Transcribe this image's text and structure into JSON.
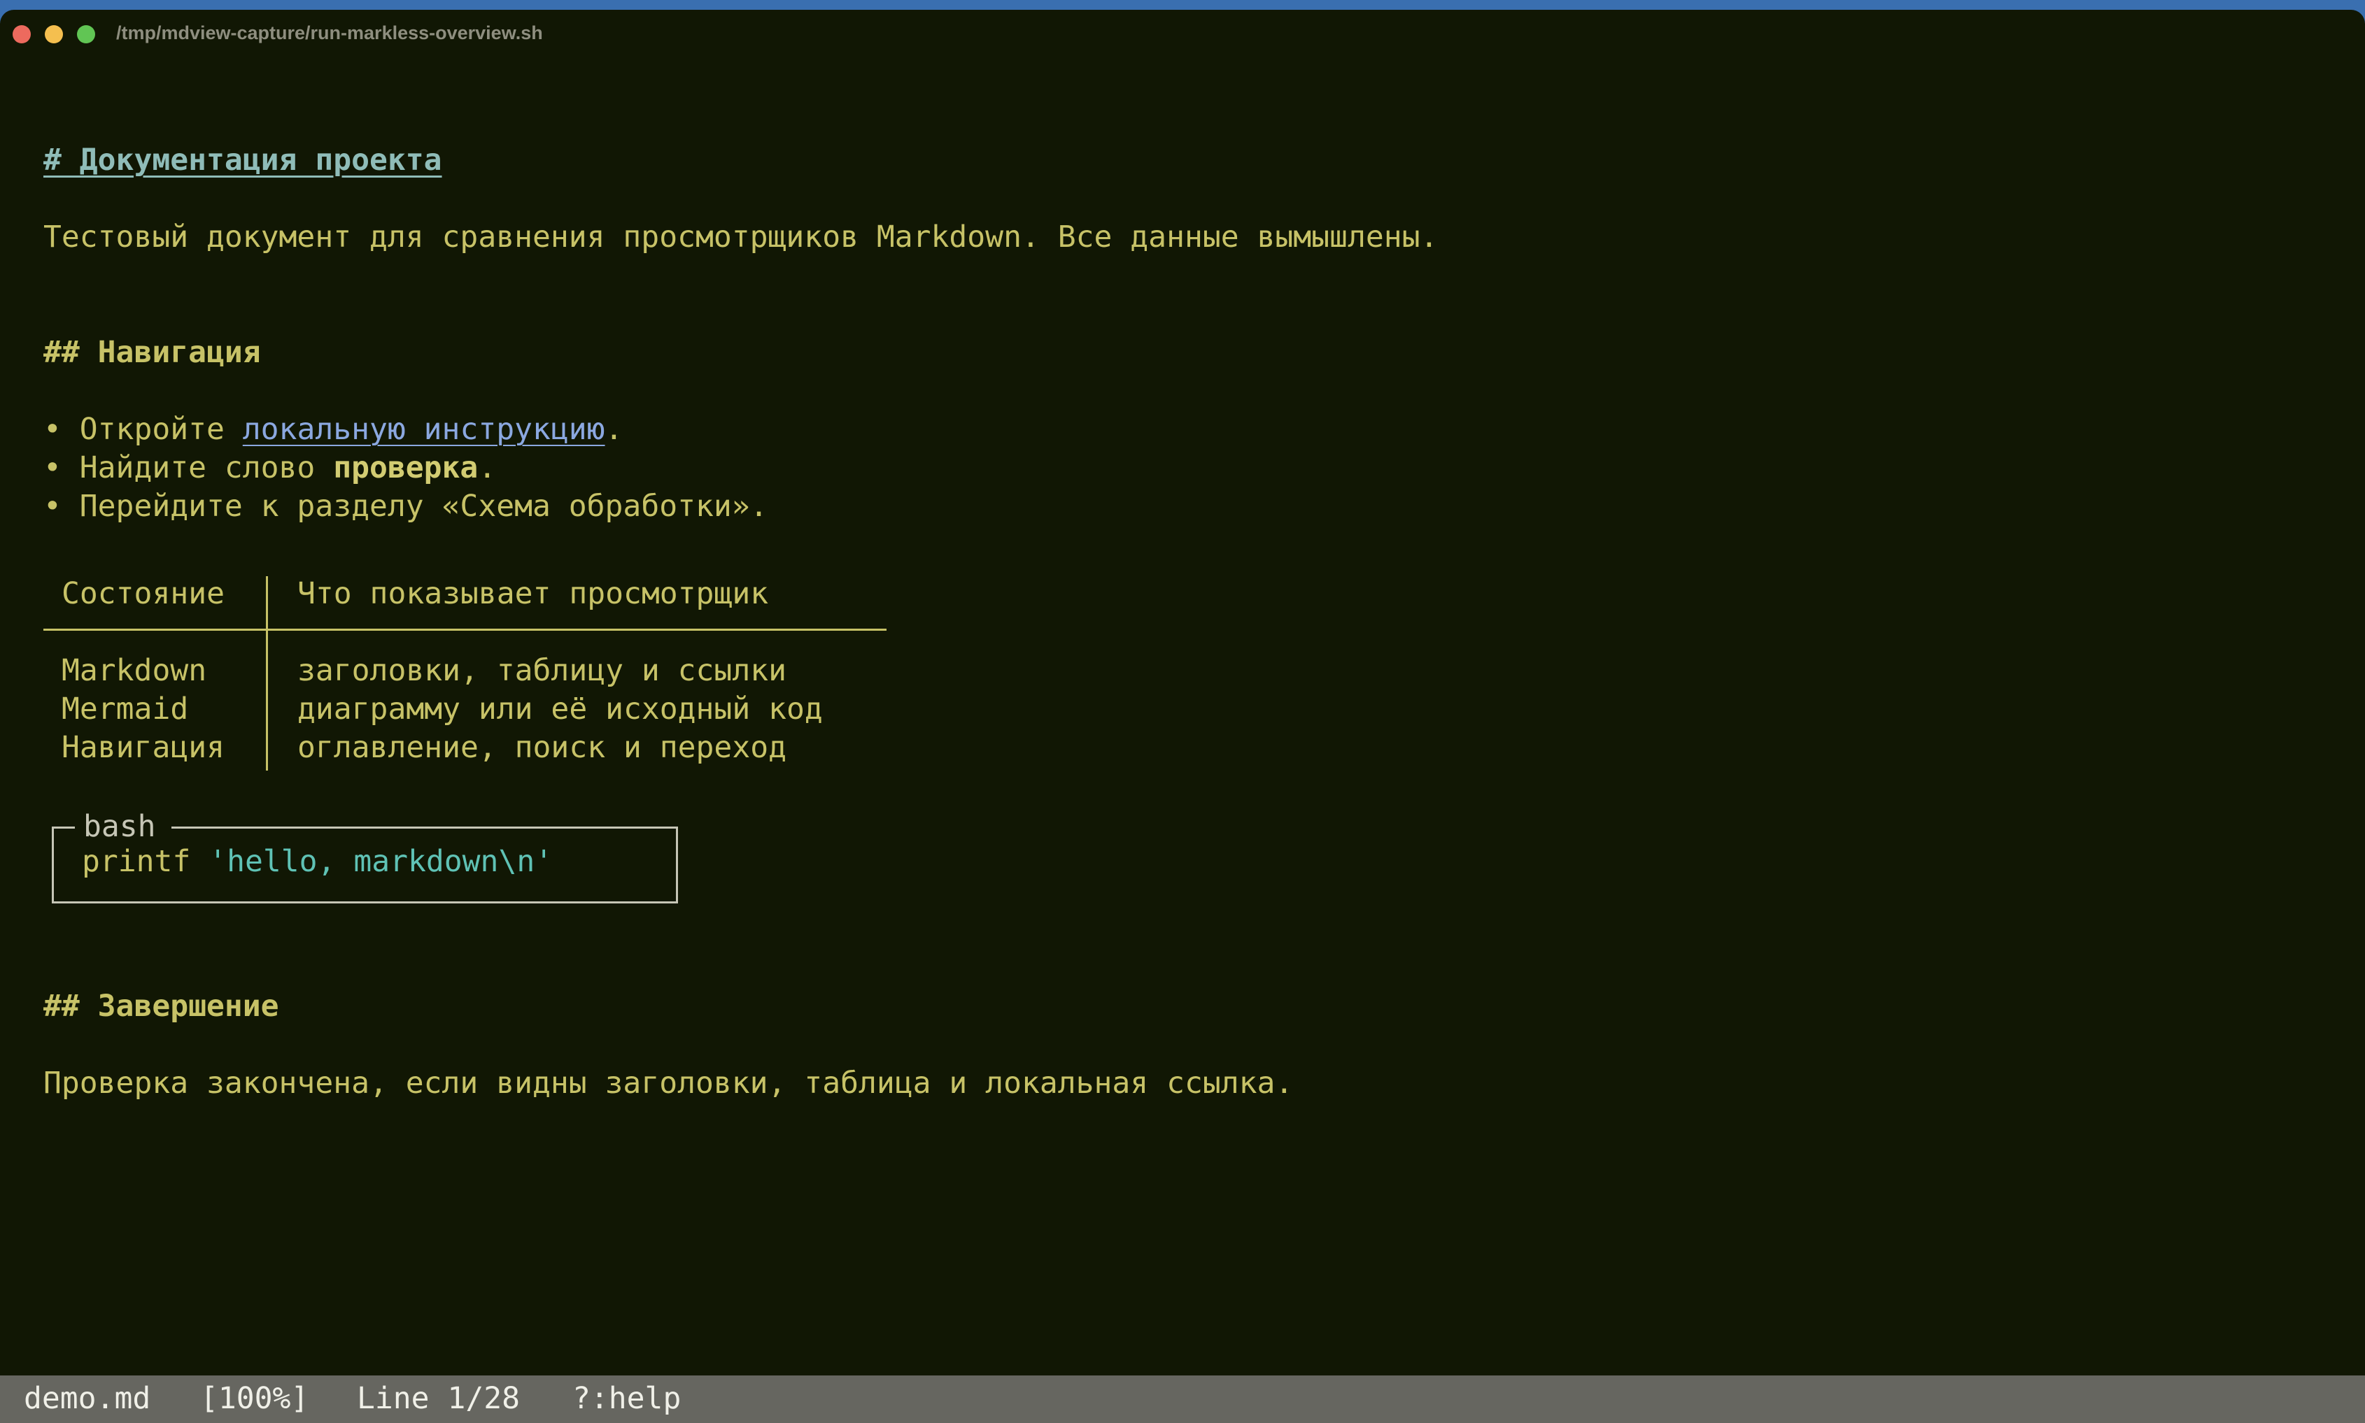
{
  "window": {
    "title": "/tmp/mdview-capture/run-markless-overview.sh"
  },
  "document": {
    "h1": "# Документация проекта",
    "intro": "Тестовый документ для сравнения просмотрщиков Markdown. Все данные вымышлены.",
    "nav_heading": "## Навигация",
    "bullets": [
      {
        "marker": "•",
        "prefix": " Откройте ",
        "link": "локальную инструкцию",
        "suffix": "."
      },
      {
        "marker": "•",
        "prefix": " Найдите слово ",
        "bold": "проверка",
        "suffix": "."
      },
      {
        "marker": "•",
        "text": " Перейдите к разделу «Схема обработки»."
      }
    ],
    "table": {
      "headers": [
        "Состояние",
        "Что показывает просмотрщик"
      ],
      "rows": [
        [
          "Markdown",
          "заголовки, таблицу и ссылки"
        ],
        [
          "Mermaid",
          "диаграмму или её исходный код"
        ],
        [
          "Навигация",
          "оглавление, поиск и переход"
        ]
      ]
    },
    "code_block": {
      "language": "bash",
      "command": "printf",
      "argument": "'hello, markdown\\n'"
    },
    "end_heading": "## Завершение",
    "end_text": "Проверка закончена, если видны заголовки, таблица и локальная ссылка."
  },
  "statusbar": {
    "filename": "demo.md",
    "percent": "[100%]",
    "line": "Line 1/28",
    "help": "?:help"
  },
  "colors": {
    "background": "#111704",
    "text": "#c7c267",
    "heading1": "#8fbcb8",
    "link": "#8ba8e0",
    "code_string": "#5fc2b5",
    "statusbar": "#666660"
  }
}
